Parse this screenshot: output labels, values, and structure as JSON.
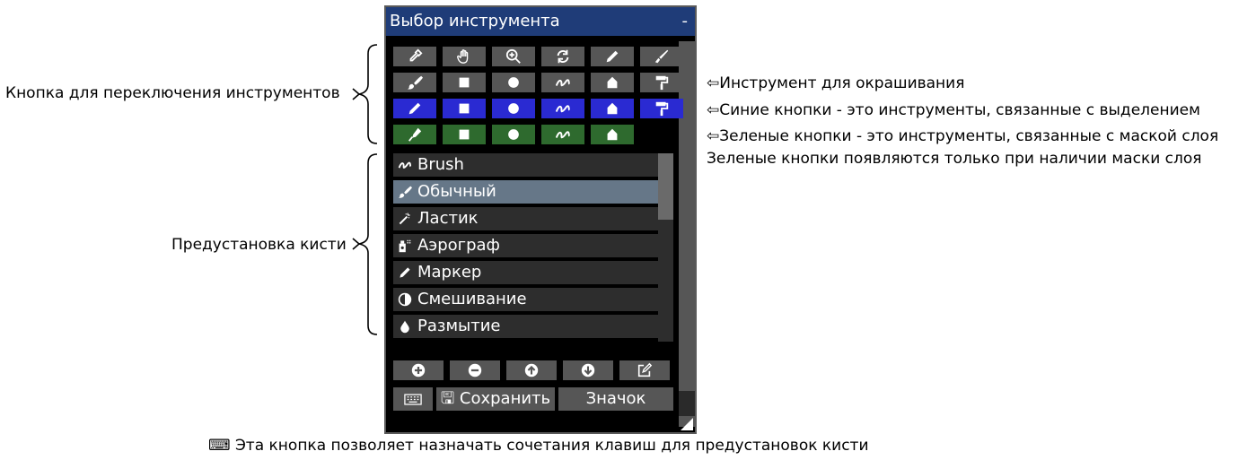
{
  "panel": {
    "title": "Выбор инструмента",
    "minimize": "-"
  },
  "tools": {
    "rows": [
      {
        "color": "gray",
        "icons": [
          "eyedropper-icon",
          "hand-icon",
          "zoom-icon",
          "rotate-icon",
          "pencil-icon",
          "ink-pen-icon"
        ]
      },
      {
        "color": "gray",
        "icons": [
          "paintbrush-icon",
          "square-icon",
          "circle-icon",
          "stroke-icon",
          "bucket-shape-icon",
          "paint-roller-icon"
        ]
      },
      {
        "color": "blue",
        "icons": [
          "pencil-icon",
          "square-icon",
          "circle-icon",
          "stroke-icon",
          "bucket-shape-icon",
          "paint-roller-icon"
        ]
      },
      {
        "color": "green",
        "icons": [
          "pen-nib-icon",
          "square-icon",
          "circle-icon",
          "stroke-icon",
          "bucket-shape-icon"
        ]
      }
    ],
    "colors": {
      "gray": "#565656",
      "blue": "#2a2ad2",
      "green": "#2e6a2e"
    }
  },
  "brushes": [
    {
      "icon": "stroke-icon",
      "label": "Brush",
      "selected": false
    },
    {
      "icon": "paintbrush-icon",
      "label": "Обычный",
      "selected": true
    },
    {
      "icon": "magic-wand-icon",
      "label": "Ластик",
      "selected": false
    },
    {
      "icon": "spray-can-icon",
      "label": "Аэрограф",
      "selected": false
    },
    {
      "icon": "pencil-icon",
      "label": "Маркер",
      "selected": false
    },
    {
      "icon": "half-circle-icon",
      "label": "Смешивание",
      "selected": false
    },
    {
      "icon": "droplet-icon",
      "label": "Размытие",
      "selected": false
    }
  ],
  "actions": [
    "plus-circle-icon",
    "minus-circle-icon",
    "arrow-up-circle-icon",
    "arrow-down-circle-icon",
    "edit-icon"
  ],
  "bottom": {
    "keyboard_icon": "keyboard-icon",
    "save_label": "🖫 Сохранить",
    "icon_label": "Значок"
  },
  "annotations": {
    "switch_tools": "Кнопка для переключения инструментов",
    "brush_preset": "Предустановка кисти",
    "paint_tool": "⇦Инструмент для окрашивания",
    "blue_buttons": "⇦Синие кнопки - это инструменты, связанные с выделением",
    "green_buttons": "⇦Зеленые кнопки - это инструменты, связанные с маской слоя",
    "green_note": "Зеленые кнопки появляются только при наличии маски слоя",
    "keyboard_note": "⌨ Эта кнопка позволяет назначать сочетания клавиш для предустановок кисти"
  }
}
